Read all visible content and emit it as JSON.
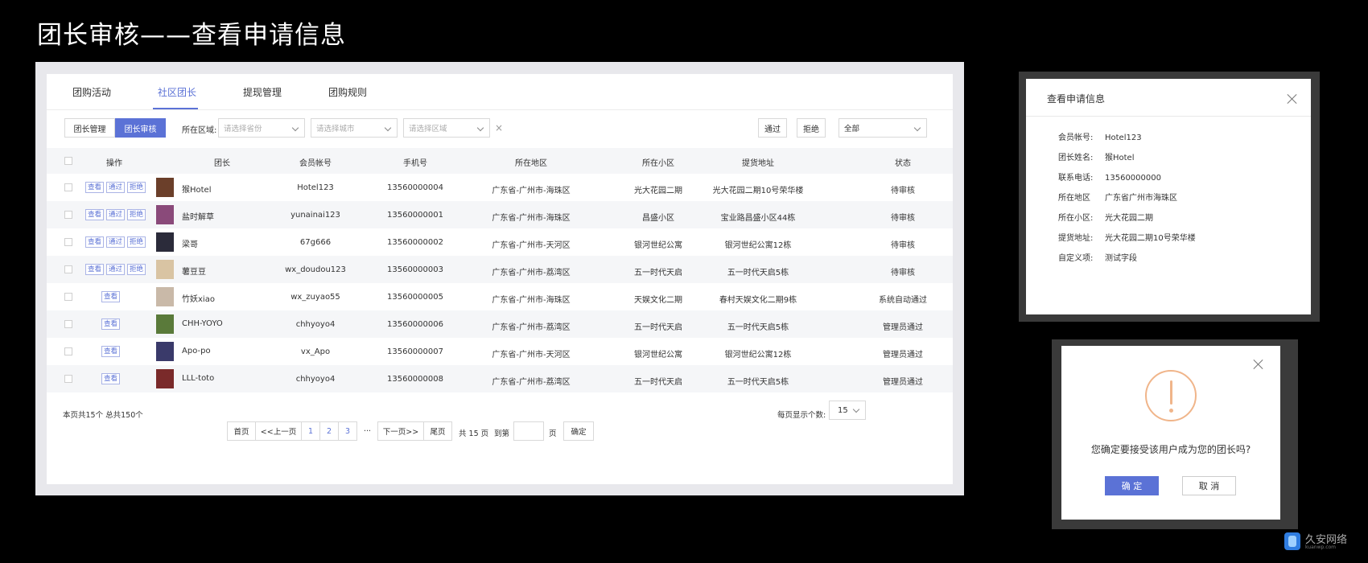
{
  "page_title": "团长审核——查看申请信息",
  "tabs": [
    {
      "label": "团购活动"
    },
    {
      "label": "社区团长"
    },
    {
      "label": "提现管理"
    },
    {
      "label": "团购规则"
    }
  ],
  "toolbar": {
    "seg_manage": "团长管理",
    "seg_review": "团长审核",
    "region_label": "所在区域:",
    "province_placeholder": "请选择省份",
    "city_placeholder": "请选择城市",
    "area_placeholder": "请选择区域",
    "clear": "×",
    "approve": "通过",
    "reject": "拒绝",
    "status_filter": "全部"
  },
  "table": {
    "headers": [
      "操作",
      "团长",
      "会员帐号",
      "手机号",
      "所在地区",
      "所在小区",
      "提货地址",
      "状态"
    ],
    "op_labels": {
      "view": "查看",
      "pass": "通过",
      "reject": "拒绝"
    },
    "rows": [
      {
        "name": "猴Hotel",
        "account": "Hotel123",
        "phone": "13560000004",
        "region": "广东省-广州市-海珠区",
        "community": "光大花园二期",
        "address": "光大花园二期10号荣华楼",
        "status": "待审核"
      },
      {
        "name": "盐时解草",
        "account": "yunainai123",
        "phone": "13560000001",
        "region": "广东省-广州市-海珠区",
        "community": "昌盛小区",
        "address": "宝业路昌盛小区44栋",
        "status": "待审核"
      },
      {
        "name": "梁哥",
        "account": "67g666",
        "phone": "13560000002",
        "region": "广东省-广州市-天河区",
        "community": "银河世纪公寓",
        "address": "银河世纪公寓12栋",
        "status": "待审核"
      },
      {
        "name": "薯豆豆",
        "account": "wx_doudou123",
        "phone": "13560000003",
        "region": "广东省-广州市-荔湾区",
        "community": "五一时代天启",
        "address": "五一时代天启5栋",
        "status": "待审核"
      },
      {
        "name": "竹妖xiao",
        "account": "wx_zuyao55",
        "phone": "13560000005",
        "region": "广东省-广州市-海珠区",
        "community": "天娱文化二期",
        "address": "春村天娱文化二期9栋",
        "status": "系统自动通过"
      },
      {
        "name": "CHH-YOYO",
        "account": "chhyoyo4",
        "phone": "13560000006",
        "region": "广东省-广州市-荔湾区",
        "community": "五一时代天启",
        "address": "五一时代天启5栋",
        "status": "管理员通过"
      },
      {
        "name": "Apo-po",
        "account": "vx_Apo",
        "phone": "13560000007",
        "region": "广东省-广州市-天河区",
        "community": "银河世纪公寓",
        "address": "银河世纪公寓12栋",
        "status": "管理员通过"
      },
      {
        "name": "LLL-toto",
        "account": "chhyoyo4",
        "phone": "13560000008",
        "region": "广东省-广州市-荔湾区",
        "community": "五一时代天启",
        "address": "五一时代天启5栋",
        "status": "管理员通过"
      }
    ]
  },
  "footer": {
    "summary": "本页共15个  总共150个",
    "per_page_label": "每页显示个数:",
    "per_page_value": "15"
  },
  "pager": {
    "first": "首页",
    "prev": "<<上一页",
    "p1": "1",
    "p2": "2",
    "p3": "3",
    "ellipsis": "···",
    "next": "下一页>>",
    "last": "尾页",
    "total": "共 15 页",
    "goto": "到第",
    "page_unit": "页",
    "confirm": "确定"
  },
  "dialog_info": {
    "title": "查看申请信息",
    "rows": [
      {
        "k": "会员帐号:",
        "v": "Hotel123"
      },
      {
        "k": "团长姓名:",
        "v": "猴Hotel"
      },
      {
        "k": "联系电话:",
        "v": "13560000000"
      },
      {
        "k": "所在地区",
        "v": "广东省广州市海珠区"
      },
      {
        "k": "所在小区:",
        "v": "光大花园二期"
      },
      {
        "k": "提货地址:",
        "v": "光大花园二期10号荣华楼"
      },
      {
        "k": "自定义项:",
        "v": "测试字段"
      }
    ]
  },
  "dialog_confirm": {
    "message": "您确定要接受该用户成为您的团长吗?",
    "ok": "确 定",
    "cancel": "取 消"
  },
  "watermark": {
    "text": "久安网络",
    "sub": "kuanwp.com"
  },
  "colors": {
    "accent": "#5b72d6",
    "warning": "#f0b58a"
  },
  "avatar_colors": [
    "#6b3f2a",
    "#8a4a7a",
    "#2b2b3a",
    "#d9c4a3",
    "#c9b9a8",
    "#5a7a3a",
    "#3a3a6a",
    "#7a2a2a"
  ]
}
